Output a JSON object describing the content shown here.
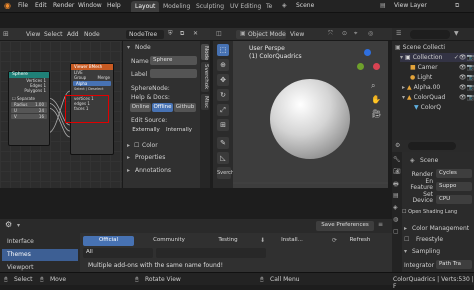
{
  "menu": {
    "items": [
      "File",
      "Edit",
      "Render",
      "Window",
      "Help"
    ],
    "workspaces": [
      "Layout",
      "Modeling",
      "Sculpting",
      "UV Editing",
      "Te"
    ],
    "scene": "Scene",
    "view_layer": "View Layer"
  },
  "node_editor": {
    "header": {
      "view": "View",
      "select": "Select",
      "add": "Add",
      "node": "Node"
    },
    "tree_name": "NodeTree",
    "nodes": {
      "sphere": {
        "title": "Sphere",
        "rows": [
          "Vertices 1",
          "Edges 1",
          "Polygons 1",
          "Separate",
          "Radius",
          "U",
          "V",
          "Rings"
        ],
        "values": {
          "radius": "1.00",
          "u": "24",
          "v": "16"
        }
      },
      "viewer": {
        "title": "Viewer BMesh",
        "rows": [
          "LIVE",
          "Group",
          "Alpha",
          "Select / Deselect"
        ],
        "group_value": "Merge",
        "alpha_value": "1"
      },
      "selected_rows": [
        "vertices 1",
        "edges 1",
        "faces 1"
      ]
    }
  },
  "node_panel": {
    "section": "Node",
    "name_label": "Name",
    "name_value": "Sphere",
    "label_label": "Label",
    "sphere_node_label": "SphereNode:",
    "help_label": "Help & Docs:",
    "buttons": [
      "Online",
      "Offline",
      "Github"
    ],
    "edit_source": "Edit Source:",
    "edit_buttons": [
      "Externally",
      "Internally"
    ],
    "color_label": "Color",
    "properties_label": "Properties",
    "annotations_label": "Annotations",
    "tabs": [
      "Node",
      "Sverchok",
      "Misc"
    ],
    "sverchok_tab": "Sverchok"
  },
  "viewport": {
    "mode": "Object Mode",
    "view": "View",
    "perspective": "User Perspe",
    "collection": "(1) ColorQuadrics",
    "side_label": "Sverch"
  },
  "outliner": {
    "items": [
      {
        "name": "Scene Collecti"
      },
      {
        "name": "Collection"
      },
      {
        "name": "Camer"
      },
      {
        "name": "Light"
      },
      {
        "name": "Alpha.00"
      },
      {
        "name": "ColorQuad"
      },
      {
        "name": "ColorQ"
      }
    ]
  },
  "properties": {
    "scene_label": "Scene",
    "rows": [
      {
        "label": "Render En",
        "value": "Cycles"
      },
      {
        "label": "Feature Set",
        "value": "Suppo"
      },
      {
        "label": "Device",
        "value": "CPU"
      },
      {
        "label": "",
        "value": "Open Shading Lang"
      }
    ],
    "sections": [
      "Color Management",
      "Freestyle",
      "Sampling"
    ],
    "integrator_label": "Integrator",
    "integrator_value": "Path Tra"
  },
  "preferences": {
    "nav": [
      "Interface",
      "Themes",
      "Viewport"
    ],
    "tabs": [
      "Official",
      "Community",
      "Testing"
    ],
    "install": "Install...",
    "refresh": "Refresh",
    "save": "Save Preferences",
    "filter_value": "All",
    "warning": "Multiple add-ons with the same name found!"
  },
  "status": {
    "select": "Select",
    "move": "Move",
    "rotate": "Rotate View",
    "call_menu": "Call Menu",
    "info": "ColorQuadrics | Verts:530 | F"
  },
  "colors": {
    "accent": "#4772b3",
    "sphere_node": "#1f8077",
    "viewer_node": "#c85a22",
    "selection": "#e00000"
  }
}
